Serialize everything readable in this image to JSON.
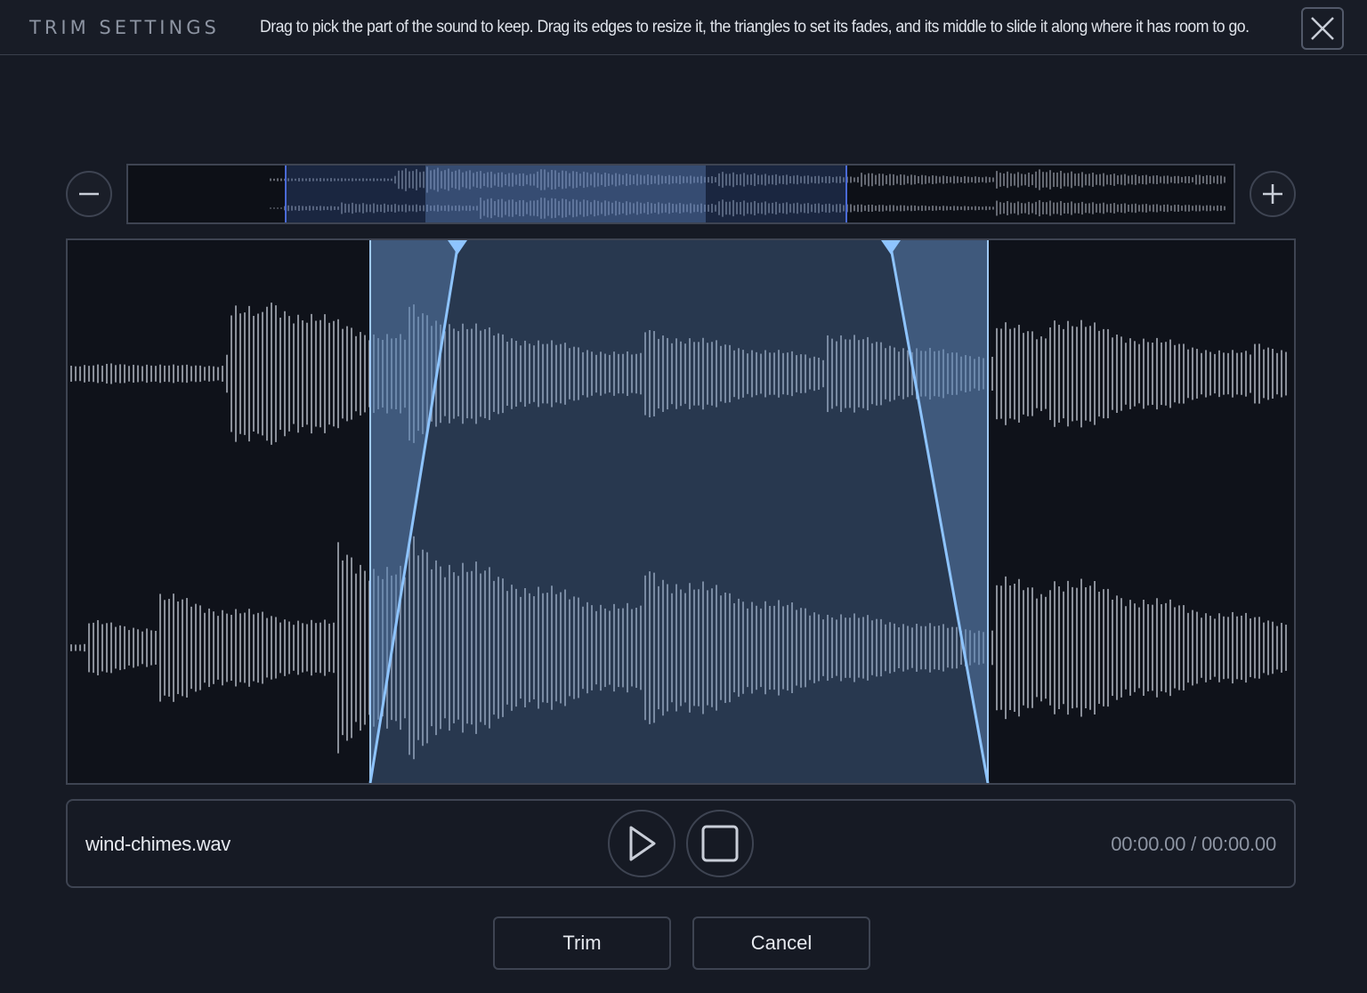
{
  "header": {
    "title": "TRIM SETTINGS",
    "instructions": "Drag to pick the part of the sound to keep. Drag its edges to resize it, the triangles to set its fades, and its middle to slide it along where it has room to go."
  },
  "icons": {
    "close": "close-icon",
    "zoom_out": "minus-icon",
    "zoom_in": "plus-icon",
    "play": "play-icon",
    "stop": "stop-icon"
  },
  "colors": {
    "background": "#161a24",
    "waveform": "#8a8f99",
    "selection_fill": "#5a82b4",
    "fade_line": "#8ec4ff",
    "overview_window_border": "#4a6ad6"
  },
  "player": {
    "filename": "wind-chimes.wav",
    "time": "00:00.00 / 00:00.00"
  },
  "actions": {
    "trim_label": "Trim",
    "cancel_label": "Cancel"
  }
}
